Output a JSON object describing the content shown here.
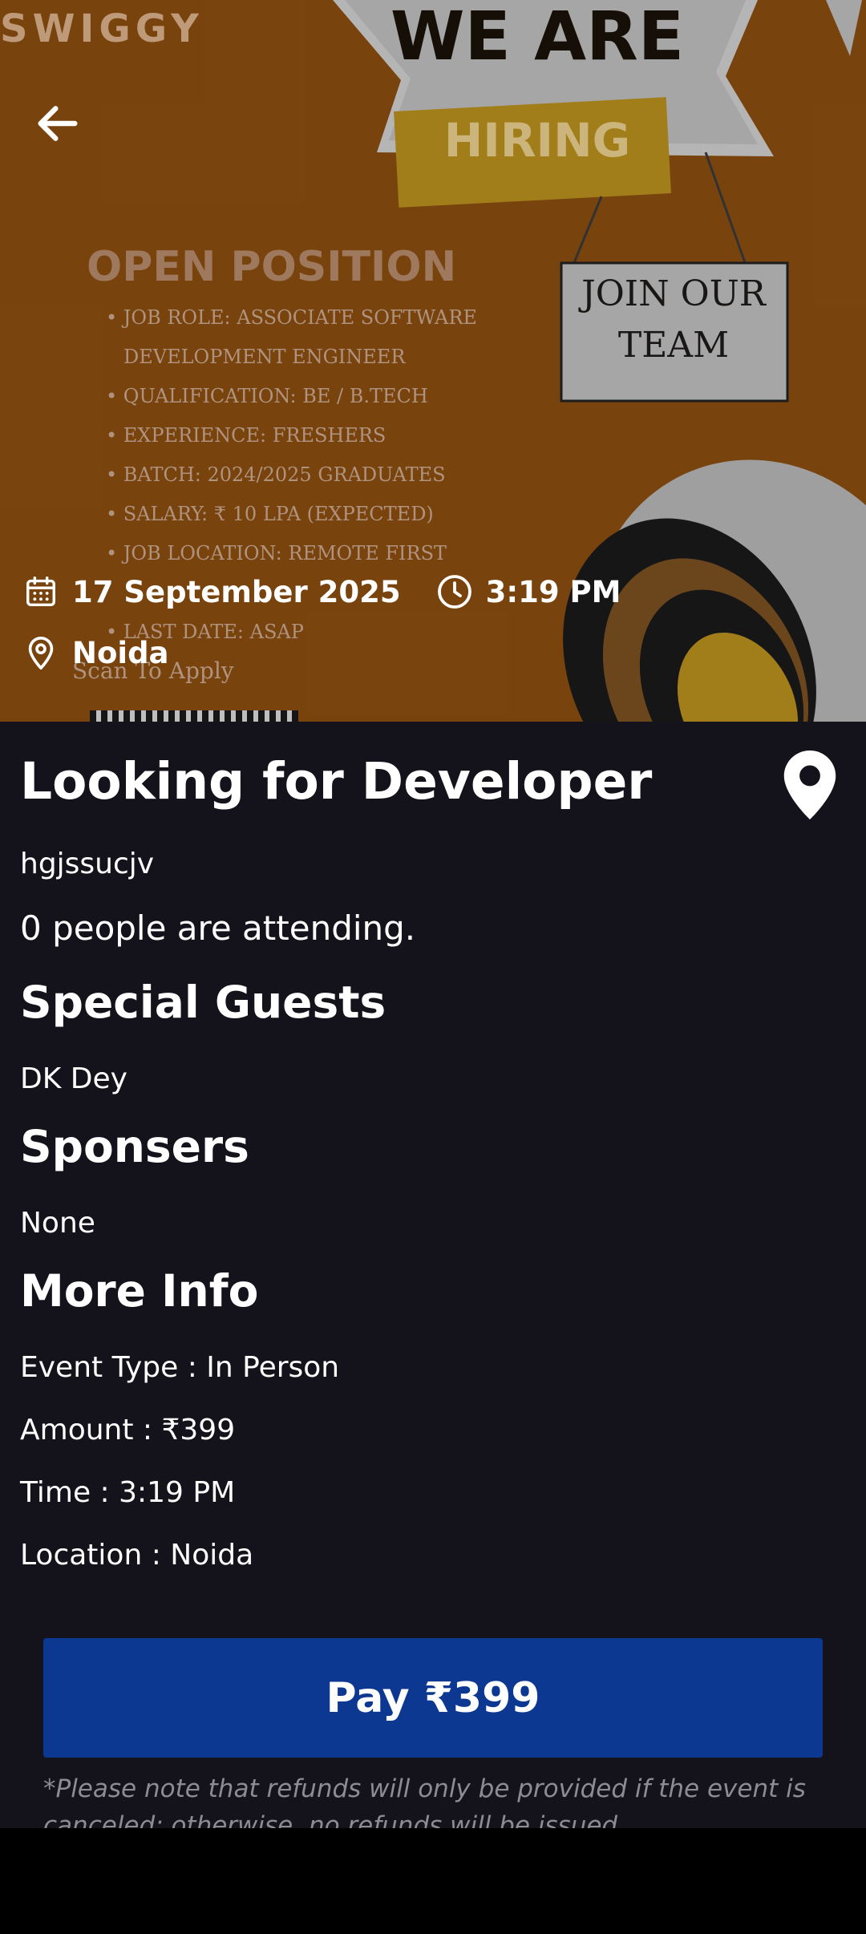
{
  "poster": {
    "brand": "SWIGGY",
    "headline": "WE ARE",
    "hiring": "HIRING",
    "sign_line1": "JOIN OUR",
    "sign_line2": "TEAM",
    "open_position": "OPEN POSITION",
    "items": [
      "• JOB ROLE: ASSOCIATE SOFTWARE",
      "DEVELOPMENT ENGINEER",
      "• QUALIFICATION: BE / B.TECH",
      "• EXPERIENCE: FRESHERS",
      "• BATCH: 2024/2025 GRADUATES",
      "• SALARY: ₹ 10 LPA (EXPECTED)",
      "• JOB LOCATION: REMOTE FIRST",
      "",
      "• LAST DATE: ASAP"
    ],
    "scan_to_apply": "Scan To Apply"
  },
  "meta": {
    "date": "17 September 2025",
    "time": "3:19 PM",
    "location": "Noida"
  },
  "event": {
    "title": "Looking for Developer",
    "description": "hgjssucjv",
    "attending": "0 people are attending."
  },
  "sections": {
    "guests_heading": "Special Guests",
    "guests_text": "DK Dey",
    "sponsors_heading": "Sponsers",
    "sponsors_text": "None",
    "more_info_heading": "More Info"
  },
  "more_info": {
    "event_type": "Event Type : In Person",
    "amount": "Amount : ₹399",
    "time": "Time : 3:19 PM",
    "location": "Location : Noida"
  },
  "pay": {
    "label": "Pay ₹399"
  },
  "refund_note": "*Please note that refunds will only be provided if the event is canceled; otherwise, no refunds will be issued.",
  "colors": {
    "background": "#14121a",
    "button": "#0c3891",
    "banner": "#8a4d10"
  }
}
